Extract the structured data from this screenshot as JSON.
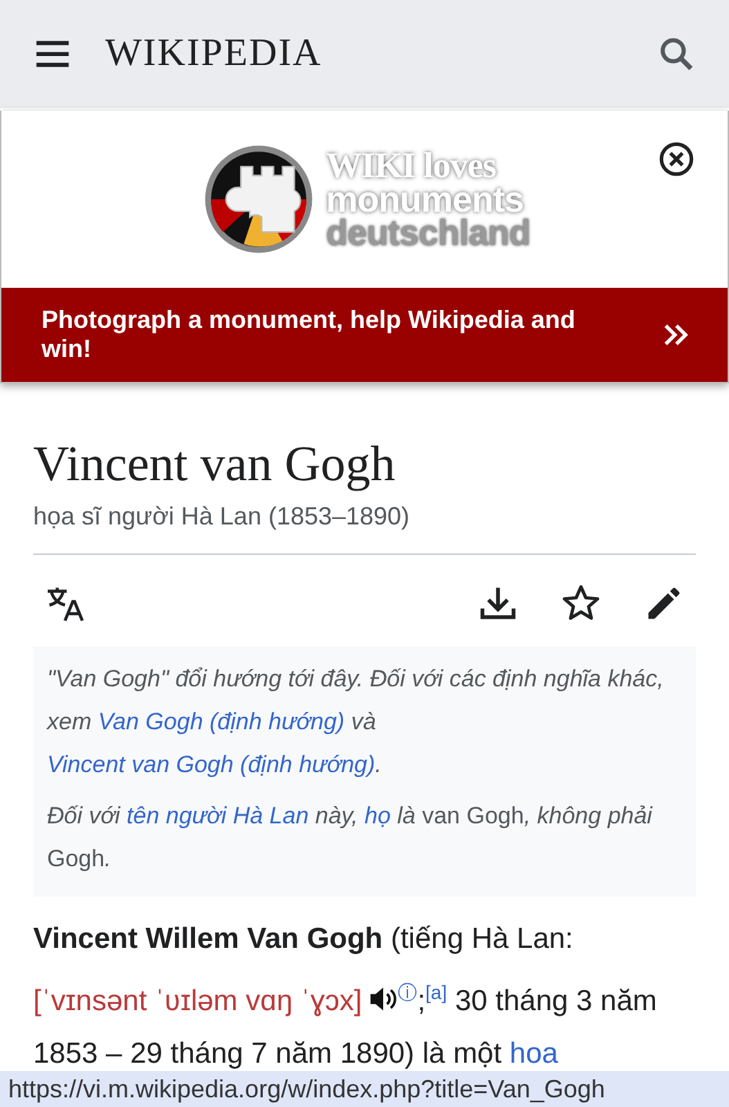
{
  "header": {
    "wordmark": "WIKIPEDIA"
  },
  "banner": {
    "logo_lines": [
      "WIKI loves",
      "monuments",
      "deutschland"
    ],
    "message": "Photograph a monument, help Wikipedia and win!"
  },
  "article": {
    "title": "Vincent van Gogh",
    "description": "họa sĩ người Hà Lan (1853–1890)"
  },
  "hatnotes": [
    [
      {
        "kind": "text",
        "text": "\"Van Gogh\" đổi hướng tới đây. Đối với các định nghĩa khác, xem "
      },
      {
        "kind": "link",
        "text": "Van Gogh (định hướng)"
      },
      {
        "kind": "text",
        "text": " và "
      },
      {
        "kind": "link",
        "text": "Vincent van Gogh (định hướng)"
      },
      {
        "kind": "text",
        "text": "."
      }
    ],
    [
      {
        "kind": "text",
        "text": "Đối với "
      },
      {
        "kind": "link",
        "text": "tên người Hà Lan"
      },
      {
        "kind": "text",
        "text": " này, "
      },
      {
        "kind": "link",
        "text": "họ"
      },
      {
        "kind": "text",
        "text": " là "
      },
      {
        "kind": "plain",
        "text": "van Gogh"
      },
      {
        "kind": "text",
        "text": ", không phải "
      },
      {
        "kind": "plain",
        "text": "Gogh"
      },
      {
        "kind": "text",
        "text": "."
      }
    ]
  ],
  "lead": [
    {
      "kind": "text",
      "text": "**Vincent Willem Van Gogh** (tiếng Hà Lan: "
    },
    {
      "kind": "ipa",
      "text": "[ˈvɪnsənt ˈʋɪləm vɑŋ ˈɣɔx]"
    },
    {
      "kind": "audio"
    },
    {
      "kind": "sup",
      "text": "ⓘ"
    },
    {
      "kind": "text",
      "text": ";"
    },
    {
      "kind": "ref",
      "text": "[a]"
    },
    {
      "kind": "text",
      "text": " 30 tháng 3 năm 1853 – 29 tháng 7 năm 1890) là một "
    },
    {
      "kind": "link",
      "text": "hoa"
    }
  ],
  "status_bar": {
    "url": "https://vi.m.wikipedia.org/w/index.php?title=Van_Gogh"
  }
}
